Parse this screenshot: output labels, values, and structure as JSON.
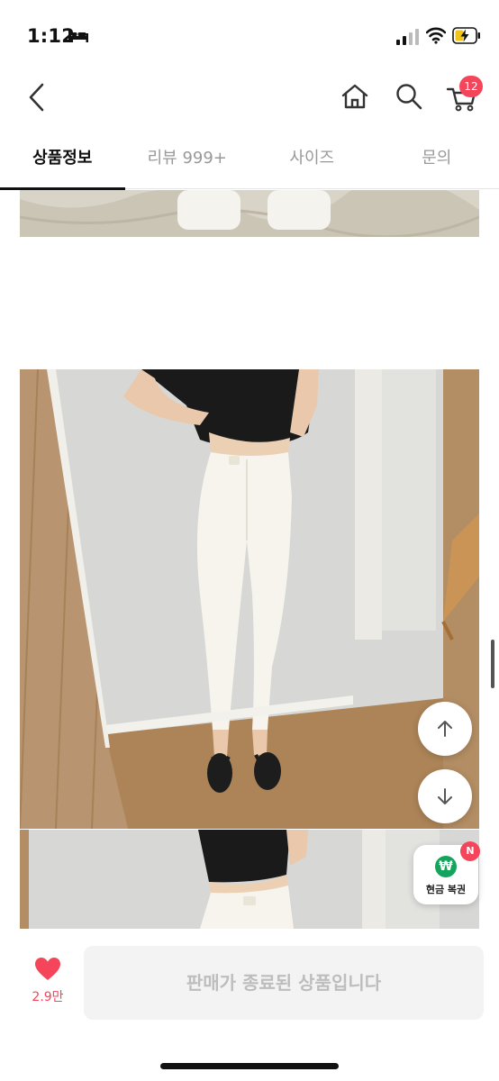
{
  "status": {
    "time": "1:12",
    "icons": [
      "bed-icon",
      "signal-icon",
      "wifi-icon",
      "battery-charging-icon"
    ]
  },
  "nav": {
    "icons": [
      "back-icon",
      "home-icon",
      "search-icon",
      "cart-icon"
    ],
    "cart_count": "12"
  },
  "tabs": [
    {
      "label": "상품정보",
      "active": true
    },
    {
      "label": "리뷰 999+",
      "active": false
    },
    {
      "label": "사이즈",
      "active": false
    },
    {
      "label": "문의",
      "active": false
    }
  ],
  "floating": {
    "scroll_up_icon": "arrow-up-icon",
    "scroll_down_icon": "arrow-down-icon",
    "cash_symbol": "₩",
    "cash_label": "현금 복권",
    "cash_badge": "N"
  },
  "bottom": {
    "like_count": "2.9만",
    "sold_out_label": "판매가 종료된 상품입니다"
  },
  "colors": {
    "accent": "#f4455a",
    "cash_green": "#14a45b",
    "disabled_bg": "#f3f3f3",
    "disabled_text": "#bdbdbd"
  }
}
